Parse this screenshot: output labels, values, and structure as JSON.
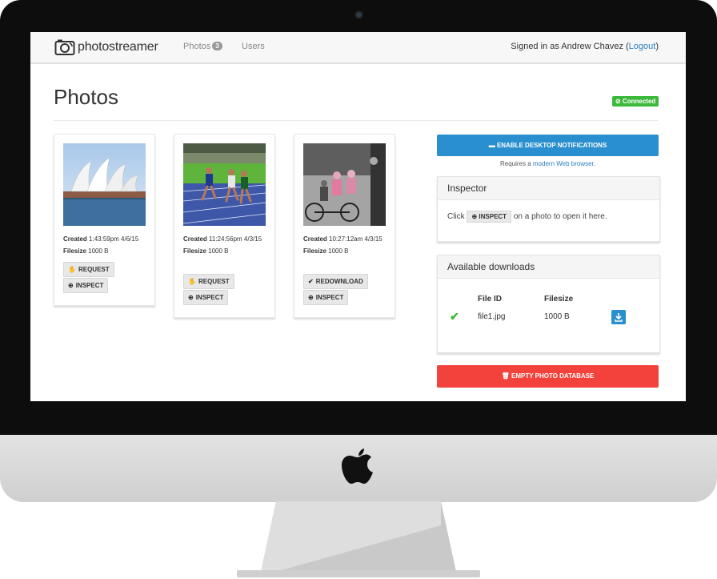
{
  "navbar": {
    "brand_light": "photo",
    "brand_bold": "streamer",
    "nav_photos": "Photos",
    "photos_count": "3",
    "nav_users": "Users",
    "signed_in_prefix": "Signed in as Andrew Chavez (",
    "logout": "Logout",
    "signed_in_suffix": ")"
  },
  "page": {
    "title": "Photos",
    "status": "Connected"
  },
  "photos": [
    {
      "created_label": "Created",
      "created": "1:43:59pm 4/6/15",
      "filesize_label": "Filesize",
      "filesize": "1000 B",
      "action": "REQUEST",
      "inspect": "INSPECT",
      "thumb": "opera-house"
    },
    {
      "created_label": "Created",
      "created": "11:24:56pm 4/3/15",
      "filesize_label": "Filesize",
      "filesize": "1000 B",
      "action": "REQUEST",
      "inspect": "INSPECT",
      "thumb": "runners"
    },
    {
      "created_label": "Created",
      "created": "10:27:12am 4/3/15",
      "filesize_label": "Filesize",
      "filesize": "1000 B",
      "action": "REDOWNLOAD",
      "inspect": "INSPECT",
      "thumb": "bicycle"
    }
  ],
  "sidebar": {
    "notify_button": "ENABLE DESKTOP NOTIFICATIONS",
    "requires_prefix": "Requires a ",
    "requires_link": "modern Web browser",
    "requires_suffix": ".",
    "inspector_title": "Inspector",
    "inspector_click": "Click",
    "inspector_button": "INSPECT",
    "inspector_suffix": "on a photo to open it here.",
    "downloads_title": "Available downloads",
    "col_file_id": "File ID",
    "col_filesize": "Filesize",
    "downloads": [
      {
        "file_id": "file1.jpg",
        "filesize": "1000 B"
      }
    ],
    "empty_button": "EMPTY PHOTO DATABASE"
  },
  "colors": {
    "primary": "#2a8fcf",
    "success": "#3cb93a",
    "danger": "#f2423b"
  }
}
